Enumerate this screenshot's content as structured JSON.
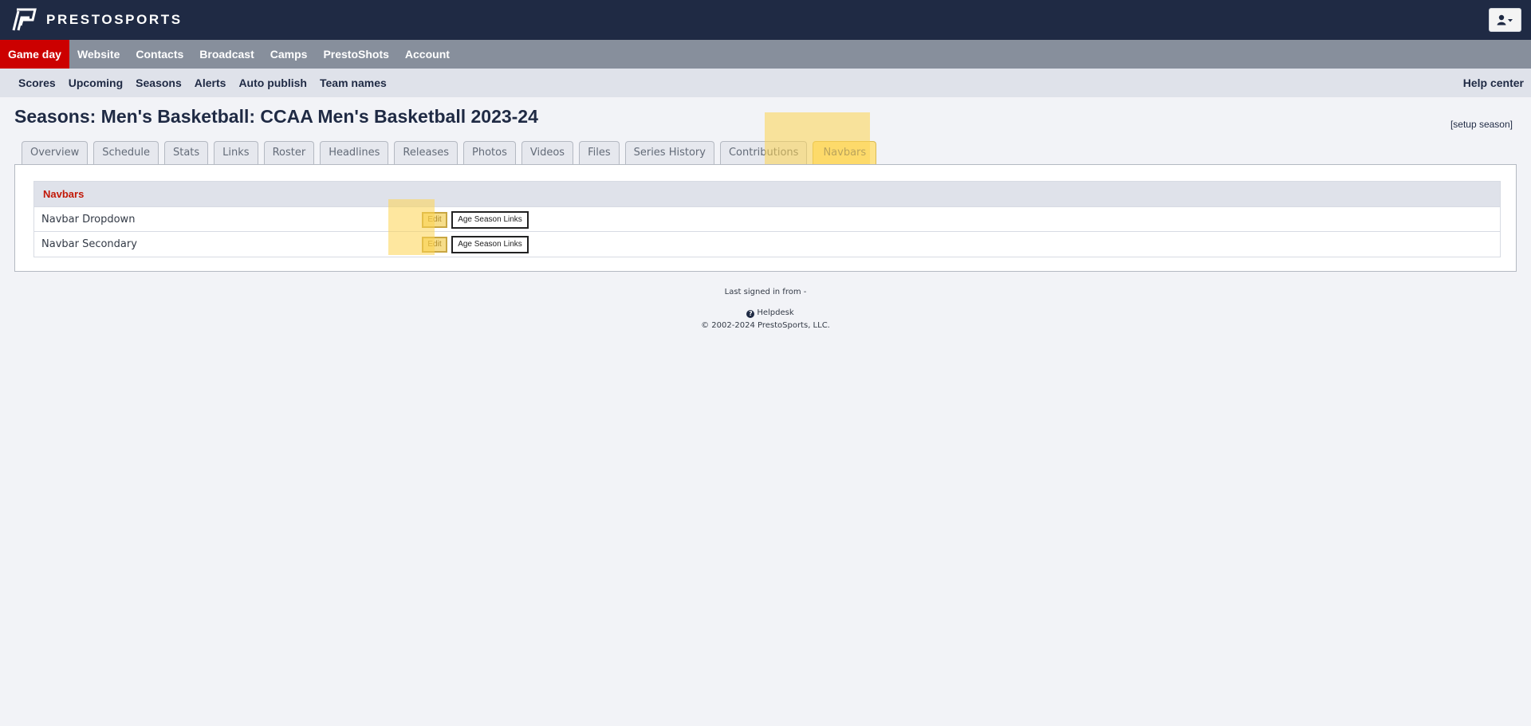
{
  "brand": {
    "name": "PRESTOSPORTS"
  },
  "topbar": {
    "user_icon": "user-icon",
    "caret": "▾"
  },
  "main_nav": {
    "items": [
      {
        "label": "Game day",
        "active": true
      },
      {
        "label": "Website"
      },
      {
        "label": "Contacts"
      },
      {
        "label": "Broadcast"
      },
      {
        "label": "Camps"
      },
      {
        "label": "PrestoShots"
      },
      {
        "label": "Account"
      }
    ]
  },
  "sub_nav": {
    "items": [
      {
        "label": "Scores"
      },
      {
        "label": "Upcoming"
      },
      {
        "label": "Seasons"
      },
      {
        "label": "Alerts"
      },
      {
        "label": "Auto publish"
      },
      {
        "label": "Team names"
      }
    ],
    "help": "Help center"
  },
  "page": {
    "title": "Seasons: Men's Basketball: CCAA Men's Basketball 2023-24",
    "setup_link": "[setup season]"
  },
  "tabs": [
    {
      "label": "Overview"
    },
    {
      "label": "Schedule"
    },
    {
      "label": "Stats"
    },
    {
      "label": "Links"
    },
    {
      "label": "Roster"
    },
    {
      "label": "Headlines"
    },
    {
      "label": "Releases"
    },
    {
      "label": "Photos"
    },
    {
      "label": "Videos"
    },
    {
      "label": "Files"
    },
    {
      "label": "Series History"
    },
    {
      "label": "Contributions"
    },
    {
      "label": "Navbars",
      "active": true
    }
  ],
  "navbars_table": {
    "header": "Navbars",
    "rows": [
      {
        "name": "Navbar Dropdown",
        "edit": "Edit",
        "age": "Age Season Links"
      },
      {
        "name": "Navbar Secondary",
        "edit": "Edit",
        "age": "Age Season Links"
      }
    ]
  },
  "footer": {
    "signed_in": "Last signed in from -",
    "helpdesk": "Helpdesk",
    "copyright": "© 2002-2024 PrestoSports, LLC."
  },
  "colors": {
    "topbar": "#1f2a44",
    "main_nav": "#878f9c",
    "active_nav": "#cc0000",
    "sub_nav": "#dfe2ea",
    "highlight": "#fdd350",
    "table_header_text": "#c21807"
  }
}
